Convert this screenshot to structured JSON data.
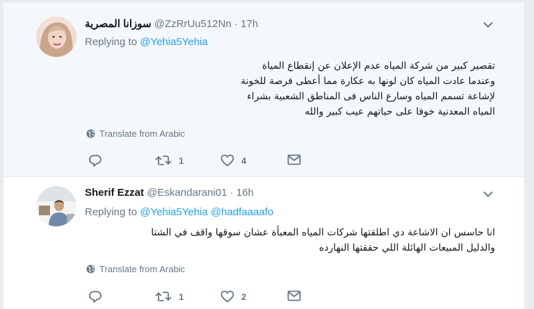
{
  "tweets": [
    {
      "display_name": "سوزانا المصرية",
      "handle": "@ZzRrUu512Nn",
      "separator": "·",
      "time": "17h",
      "replying_prefix": "Replying to",
      "replying_to": [
        "@Yehia5Yehia"
      ],
      "text_lines": [
        "تقصير كبير من شركة المياه عدم الإعلان عن إنقطاع المياة",
        "وعندما عادت المياه كان لونها به عكارة مما أعطى فرصة للخونة",
        "لإشاعة تسمم المياه وسارع الناس فى المناطق الشعبية بشراء",
        "المياه المعدنية خوفا على حياتهم عيب كبير والله"
      ],
      "translate_label": "Translate from Arabic",
      "reply_count": "",
      "retweet_count": "1",
      "like_count": "4"
    },
    {
      "display_name": "Sherif Ezzat",
      "handle": "@Eskandarani01",
      "separator": "·",
      "time": "16h",
      "replying_prefix": "Replying to",
      "replying_to": [
        "@Yehia5Yehia",
        "@hadfaaaafo"
      ],
      "text_lines": [
        "انا حاسس ان الاشاعة دي اطلقتها شركات المياه المعبأة عشان سوقها واقف في الشتا",
        "والدليل المبيعات الهائلة اللي حققتها النهارده"
      ],
      "translate_label": "Translate from Arabic",
      "reply_count": "",
      "retweet_count": "1",
      "like_count": "2"
    }
  ],
  "icons": {
    "reply": "reply-icon",
    "retweet": "retweet-icon",
    "like": "heart-icon",
    "message": "envelope-icon",
    "globe": "globe-icon",
    "caret": "chevron-down-icon"
  },
  "colors": {
    "link": "#1da1f2",
    "muted": "#657786",
    "text": "#14171a",
    "highlight_bg": "#f5f8fa",
    "page_bg": "#e6ecf0"
  }
}
